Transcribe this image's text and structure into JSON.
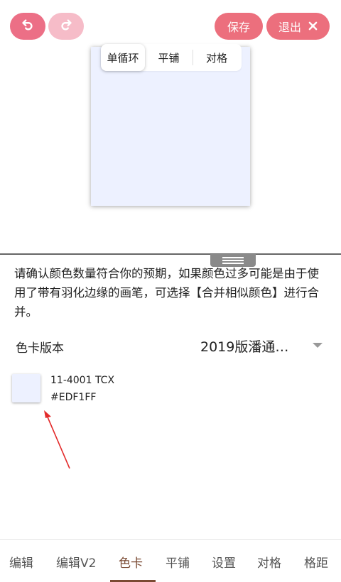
{
  "toolbar": {
    "undo_icon": "undo-icon",
    "redo_icon": "redo-icon",
    "save_label": "保存",
    "exit_label": "退出",
    "exit_icon": "close-icon",
    "accent_color": "#ec6f7d"
  },
  "preview": {
    "color": "#EDF1FF",
    "tabs": [
      "单循环",
      "平铺",
      "对格"
    ],
    "active_tab": "单循环"
  },
  "info_text": "请确认颜色数量符合你的预期，如果颜色过多可能是由于使用了带有羽化边缘的画笔，可选择【合并相似颜色】进行合并。",
  "color_card": {
    "version_label": "色卡版本",
    "version_value": "2019版潘通…"
  },
  "swatches": [
    {
      "code": "11-4001 TCX",
      "hex": "#EDF1FF"
    }
  ],
  "bottom_nav": {
    "items": [
      "编辑",
      "编辑V2",
      "色卡",
      "平铺",
      "设置",
      "对格",
      "格距"
    ],
    "active": "色卡",
    "active_color": "#7a4a33"
  }
}
